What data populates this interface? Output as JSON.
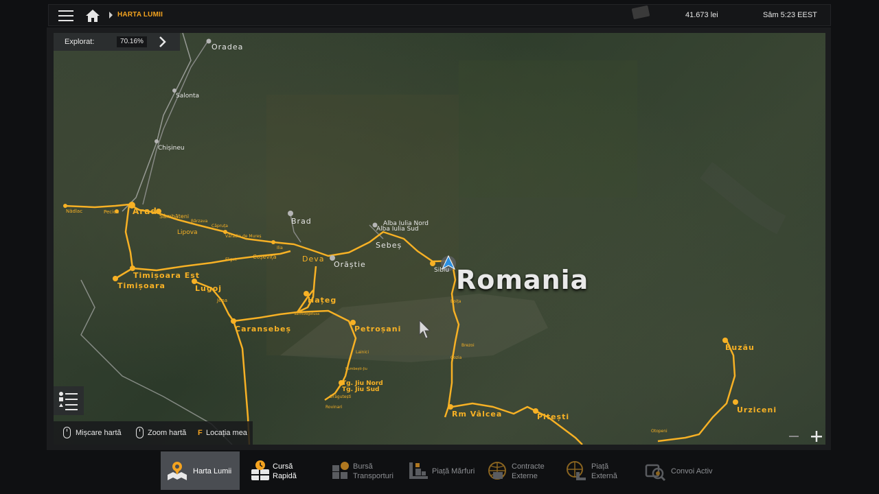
{
  "header": {
    "breadcrumb": "HARTA LUMII",
    "money": "41.673 lei",
    "clock": "Sâm 5:23 EEST"
  },
  "explored": {
    "label": "Explorat:",
    "value": "70.16%"
  },
  "map": {
    "country_label": "Romania",
    "cities_major": [
      "Oradea",
      "Salonta",
      "Chișineu",
      "Arad",
      "Brad",
      "Alba Iulia Nord",
      "Alba Iulia Sud",
      "Sebeș",
      "Orăștie",
      "Deva",
      "Timișoara Est",
      "Timișoara",
      "Lugoj",
      "Hațeg",
      "Caransebeș",
      "Petroșani",
      "Tg. Jiu Nord",
      "Tg. Jiu Sud",
      "Rm Vâlcea",
      "Pitești",
      "Buzău",
      "Urziceni",
      "Sibiu"
    ],
    "cities_minor": [
      "Nădlac",
      "Pecica",
      "Sâmbăteni",
      "Lipova",
      "Bârzava",
      "Căpruța",
      "Vărădia de Mureș",
      "Ilia",
      "Coșevița",
      "Făget",
      "Jena",
      "Sarmizegetusa",
      "Boița",
      "Brezoi",
      "Cozia",
      "Lainici",
      "Bumbești-Jiu",
      "Drăgutești",
      "Rovinari",
      "Otopeni"
    ]
  },
  "controls": {
    "hint_move": "Mișcare hartă",
    "hint_zoom": "Zoom hartă",
    "hint_key": "F",
    "hint_location": "Locația mea",
    "zoom_minus": "−",
    "zoom_plus": "+"
  },
  "tabs": [
    {
      "line1": "Harta Lumii",
      "line2": "",
      "icon": "world-map-icon",
      "active": true
    },
    {
      "line1": "Cursă",
      "line2": "Rapidă",
      "icon": "quick-job-icon",
      "active": false
    },
    {
      "line1": "Bursă",
      "line2": "Transporturi",
      "icon": "freight-market-icon",
      "active": false
    },
    {
      "line1": "Piață Mărfuri",
      "line2": "",
      "icon": "cargo-market-icon",
      "active": false
    },
    {
      "line1": "Contracte",
      "line2": "Externe",
      "icon": "external-contracts-icon",
      "active": false
    },
    {
      "line1": "Piață",
      "line2": "Externă",
      "icon": "external-market-icon",
      "active": false
    },
    {
      "line1": "Convoi Activ",
      "line2": "",
      "icon": "convoy-icon",
      "active": false
    }
  ],
  "colors": {
    "accent": "#f4a31f",
    "road": "#f7b125",
    "active_tab": "#4a4d52",
    "player_marker": "#2b8fe0"
  }
}
